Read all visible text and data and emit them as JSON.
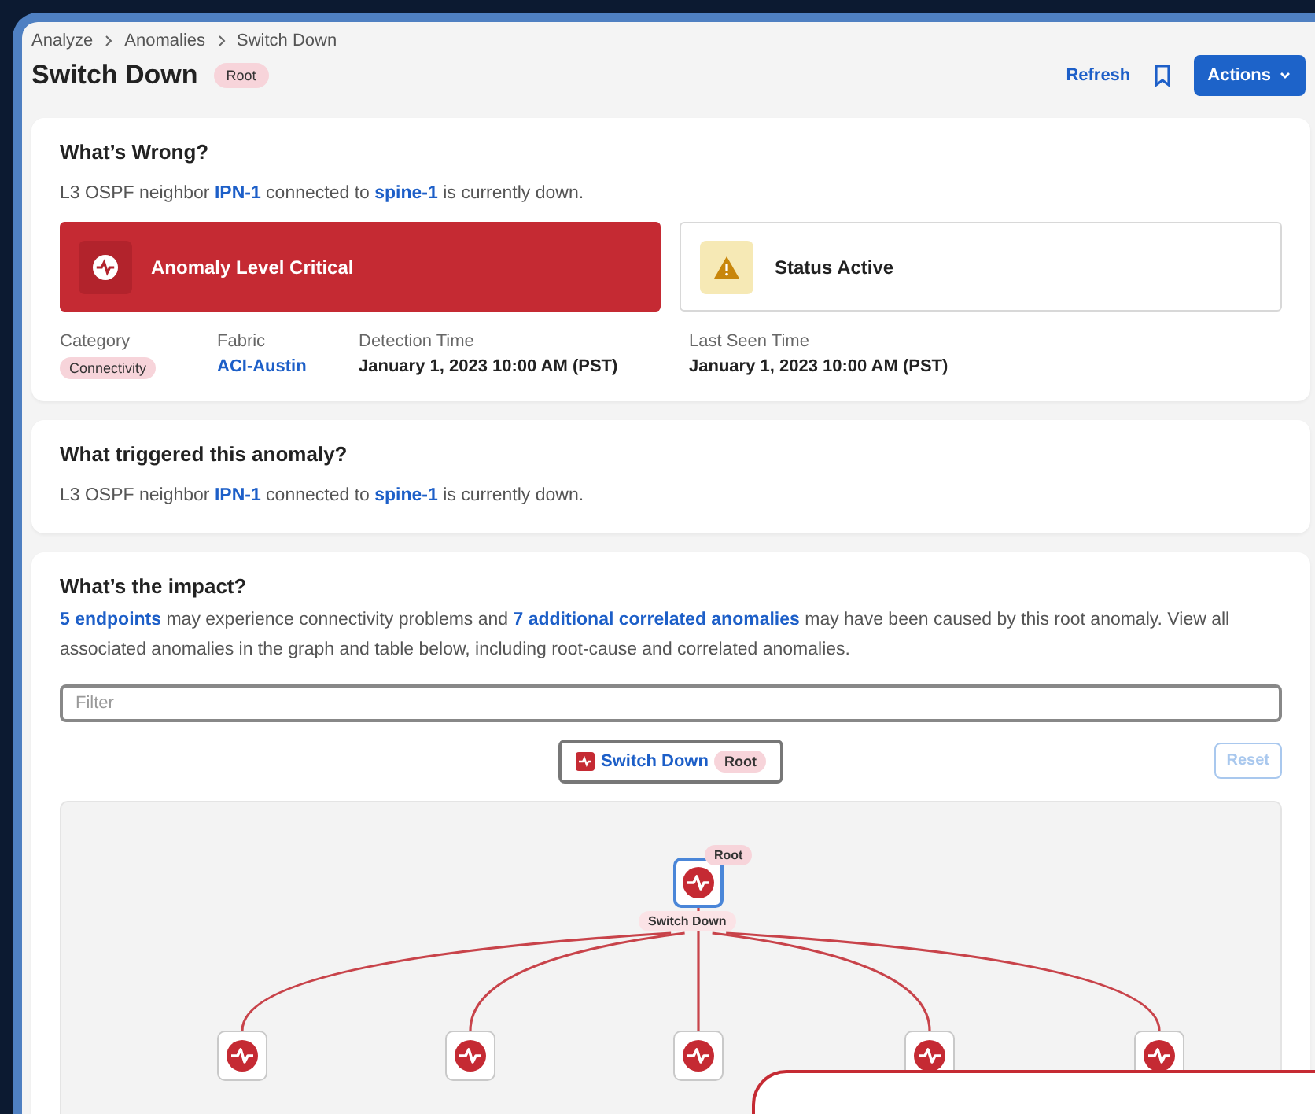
{
  "breadcrumb": [
    "Analyze",
    "Anomalies",
    "Switch Down"
  ],
  "title": "Switch Down",
  "title_badge": "Root",
  "toolbar": {
    "refresh": "Refresh",
    "actions": "Actions"
  },
  "whats_wrong": {
    "heading": "What’s Wrong?",
    "description": [
      {
        "kind": "plain",
        "text": "L3 OSPF neighbor "
      },
      {
        "kind": "link",
        "text": "IPN-1"
      },
      {
        "kind": "plain",
        "text": " connected to "
      },
      {
        "kind": "link",
        "text": "spine-1"
      },
      {
        "kind": "plain",
        "text": " is currently down."
      }
    ],
    "level_card": {
      "label": "Anomaly Level Critical"
    },
    "status_card": {
      "label": "Status Active"
    },
    "details": [
      {
        "label": "Category",
        "value": "Connectivity",
        "kind": "tag"
      },
      {
        "label": "Fabric",
        "value": "ACI-Austin",
        "kind": "link"
      },
      {
        "label": "Detection Time",
        "value": "January 1, 2023 10:00 AM (PST)",
        "kind": "text"
      },
      {
        "label": "Last Seen Time",
        "value": "January 1, 2023 10:00 AM (PST)",
        "kind": "text"
      }
    ]
  },
  "trigger": {
    "heading": "What triggered this anomaly?",
    "description": [
      {
        "kind": "plain",
        "text": "L3 OSPF neighbor "
      },
      {
        "kind": "link",
        "text": "IPN-1"
      },
      {
        "kind": "plain",
        "text": " connected to "
      },
      {
        "kind": "link",
        "text": "spine-1"
      },
      {
        "kind": "plain",
        "text": " is currently down."
      }
    ]
  },
  "impact": {
    "heading": "What’s the impact?",
    "description": [
      {
        "kind": "link",
        "text": "5 endpoints"
      },
      {
        "kind": "plain",
        "text": " may experience connectivity problems and "
      },
      {
        "kind": "link",
        "text": "7 additional correlated anomalies"
      },
      {
        "kind": "plain",
        "text": " may have been caused by this root anomaly. View all associated anomalies in the graph and table below, including root-cause and correlated anomalies."
      }
    ],
    "filter": {
      "placeholder": "Filter"
    },
    "chip": {
      "label": "Switch Down",
      "badge": "Root"
    },
    "reset": {
      "label": "Reset",
      "disabled": true
    },
    "graph": {
      "root": {
        "label": "Switch Down",
        "badge": "Root",
        "selected": true
      },
      "children": [
        {
          "kind": "anomaly"
        },
        {
          "kind": "anomaly"
        },
        {
          "kind": "anomaly"
        },
        {
          "kind": "anomaly"
        },
        {
          "kind": "anomaly"
        }
      ]
    }
  },
  "overlay": {
    "visible": true
  }
}
